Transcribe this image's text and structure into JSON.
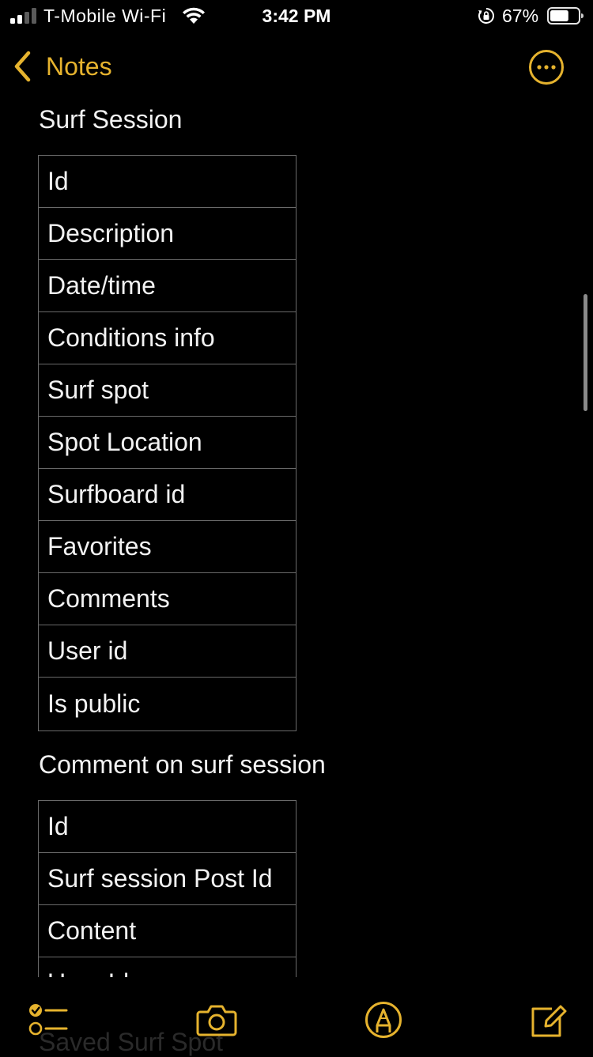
{
  "status_bar": {
    "carrier": "T-Mobile Wi-Fi",
    "time": "3:42 PM",
    "battery_percent": "67%",
    "battery_level": 0.67,
    "signal_bars": 2
  },
  "nav": {
    "back_label": "Notes",
    "accent_color": "#e6b32e",
    "more_icon": "ellipsis-circle-icon"
  },
  "note": {
    "sections": [
      {
        "heading": "Surf Session",
        "rows": [
          "Id",
          "Description",
          "Date/time",
          "Conditions info",
          "Surf spot",
          "Spot Location",
          "Surfboard id",
          "Favorites",
          "Comments",
          "User id",
          "Is public"
        ]
      },
      {
        "heading": "Comment on surf session",
        "rows": [
          "Id",
          "Surf session Post Id",
          "Content",
          "User Id"
        ]
      },
      {
        "heading": "Saved Surf Spot",
        "rows": []
      }
    ]
  },
  "toolbar": {
    "items": [
      "checklist-icon",
      "camera-icon",
      "markup-icon",
      "compose-icon"
    ]
  }
}
